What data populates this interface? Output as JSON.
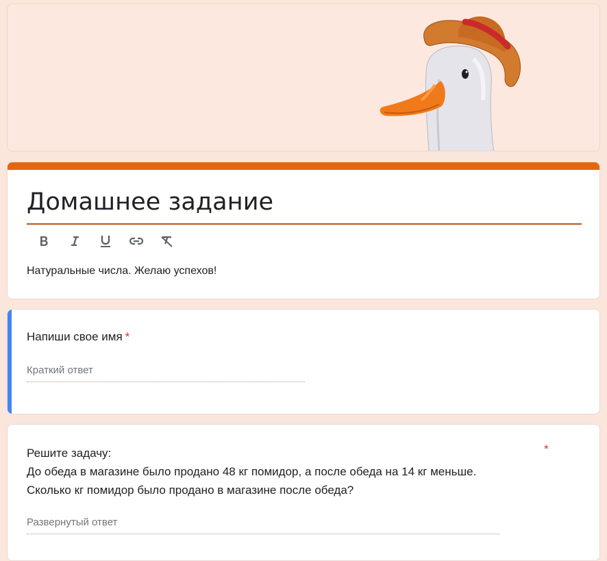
{
  "header": {
    "image": "goose-with-hat-illustration"
  },
  "form": {
    "title": "Домашнее задание",
    "description": "Натуральные числа. Желаю успехов!",
    "accent_color": "#e8650f",
    "toolbar": {
      "bold": "B",
      "italic": "I",
      "underline": "U",
      "link_icon": "link-icon",
      "clear_format_icon": "clear-format-icon"
    }
  },
  "questions": [
    {
      "label": "Напиши свое имя",
      "required": "*",
      "placeholder": "Краткий ответ",
      "active_color": "#4285f4"
    },
    {
      "line1": "Решите задачу:",
      "line2": "До обеда в магазине было продано 48 кг помидор, а после обеда на 14 кг меньше.",
      "line3": "Сколько кг помидор было продано в магазине после обеда?",
      "required": "*",
      "placeholder": "Развернутый ответ"
    }
  ]
}
